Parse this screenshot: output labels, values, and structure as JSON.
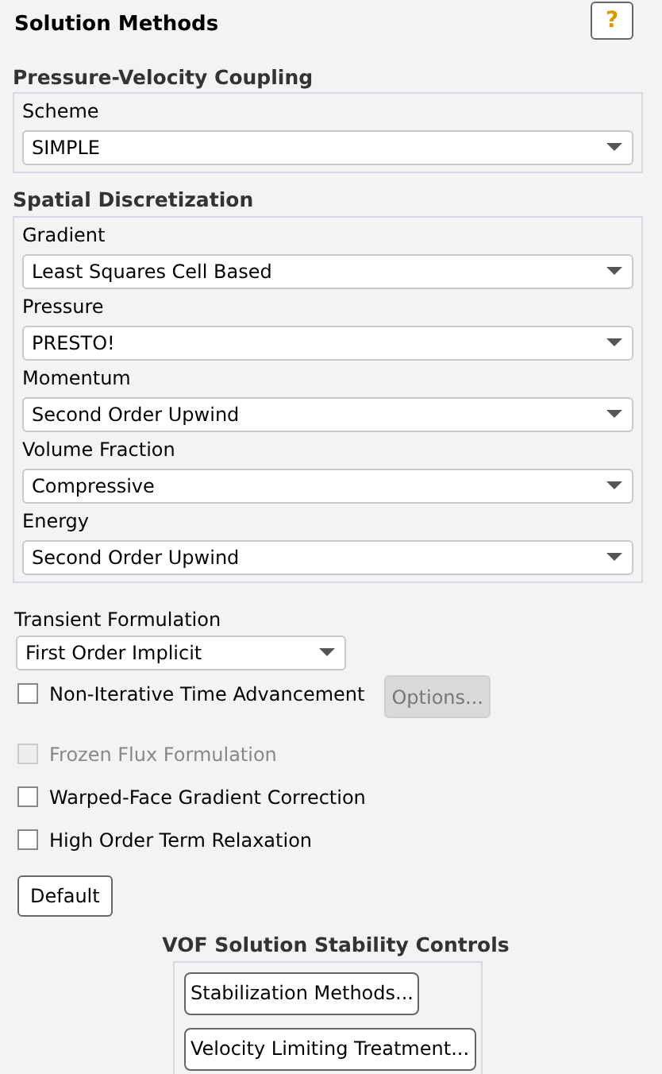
{
  "title": "Solution Methods",
  "help_button": "?",
  "coupling": {
    "heading": "Pressure-Velocity Coupling",
    "fields": [
      {
        "label": "Scheme",
        "value": "SIMPLE"
      }
    ]
  },
  "spatial": {
    "heading": "Spatial Discretization",
    "fields": [
      {
        "label": "Gradient",
        "value": "Least Squares Cell Based"
      },
      {
        "label": "Pressure",
        "value": "PRESTO!"
      },
      {
        "label": "Momentum",
        "value": "Second Order Upwind"
      },
      {
        "label": "Volume Fraction",
        "value": "Compressive"
      },
      {
        "label": "Energy",
        "value": "Second Order Upwind"
      }
    ]
  },
  "transient": {
    "label": "Transient Formulation",
    "value": "First Order Implicit"
  },
  "options": [
    {
      "label": "Non-Iterative Time Advancement",
      "checked": false,
      "disabled": false,
      "button": {
        "label": "Options...",
        "disabled": true
      }
    },
    {
      "label": "Frozen Flux Formulation",
      "checked": false,
      "disabled": true
    },
    {
      "label": "Warped-Face Gradient Correction",
      "checked": false,
      "disabled": false
    },
    {
      "label": "High Order Term Relaxation",
      "checked": false,
      "disabled": false
    }
  ],
  "default_button": "Default",
  "vof": {
    "heading": "VOF Solution Stability Controls",
    "buttons": [
      "Stabilization Methods...",
      "Velocity Limiting Treatment..."
    ]
  }
}
